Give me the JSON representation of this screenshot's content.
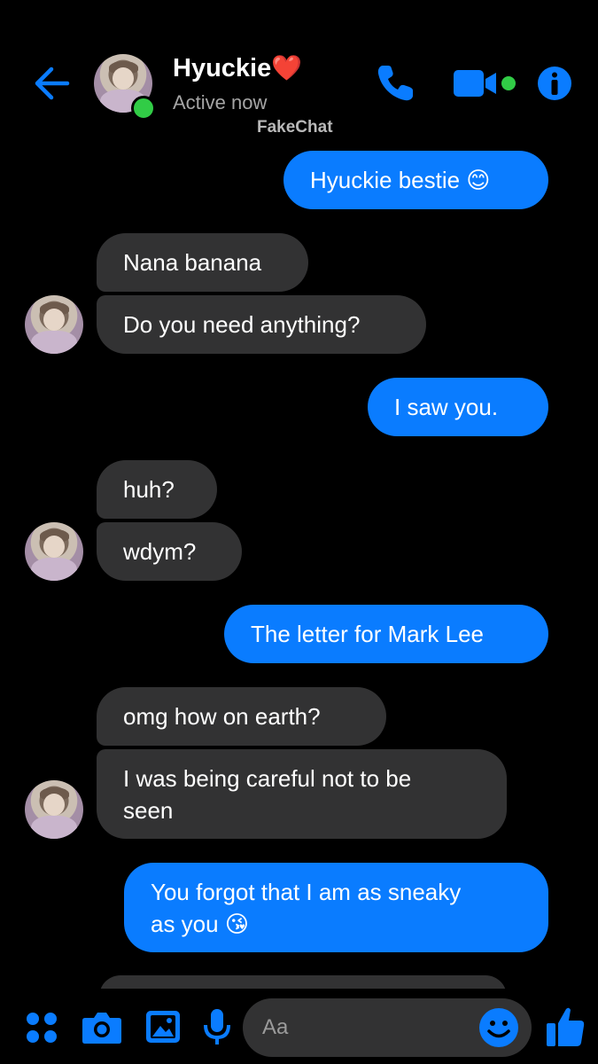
{
  "header": {
    "contact_name": "Hyuckie",
    "heart": "❤️",
    "status": "Active now",
    "watermark": "FakeChat",
    "icons": [
      "back-arrow-icon",
      "phone-icon",
      "video-camera-icon",
      "info-icon"
    ]
  },
  "messages": [
    {
      "side": "out",
      "text": "Hyuckie bestie 😊"
    },
    {
      "side": "in",
      "text": "Nana banana"
    },
    {
      "side": "in",
      "text": "Do you need anything?"
    },
    {
      "side": "out",
      "text": "I saw you."
    },
    {
      "side": "in",
      "text": "huh?"
    },
    {
      "side": "in",
      "text": "wdym?"
    },
    {
      "side": "out",
      "text": "The letter for Mark Lee"
    },
    {
      "side": "in",
      "text": "omg how on earth?"
    },
    {
      "side": "in",
      "text_line1": "I was being careful not to be",
      "text_line2": "seen"
    },
    {
      "side": "out",
      "text_line1": "You forgot that I am as sneaky",
      "text_line2": "as you 😘"
    }
  ],
  "composer": {
    "placeholder": "Aa",
    "icons": [
      "apps-grid-icon",
      "camera-icon",
      "gallery-icon",
      "microphone-icon",
      "emoji-icon",
      "thumbs-up-icon"
    ]
  },
  "colors": {
    "accent": "#0a7cff",
    "incoming_bubble": "#323233",
    "background": "#000000",
    "online": "#31cc46"
  }
}
